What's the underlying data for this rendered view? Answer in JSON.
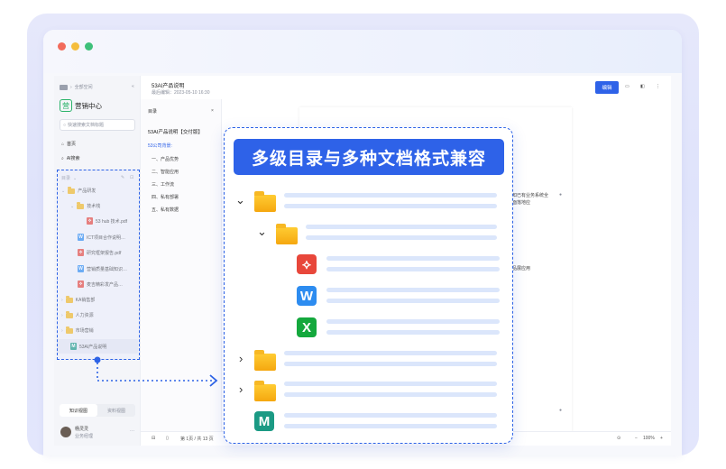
{
  "sidebar": {
    "breadcrumb": [
      "首页",
      "全部空间"
    ],
    "space_title": "营销中心",
    "space_logo_char": "营",
    "search_placeholder": "快速搜索文档标题",
    "nav": [
      {
        "label": "首页"
      },
      {
        "label": "AI搜索"
      }
    ],
    "dir_label": "目录",
    "tree": [
      {
        "label": "产品研发",
        "type": "folder",
        "level": 0
      },
      {
        "label": "技术栈",
        "type": "folder",
        "level": 1
      },
      {
        "label": "53 hub 技术.pdf",
        "type": "pdf",
        "level": 2
      },
      {
        "label": "ICT项目合作说明…",
        "type": "word",
        "level": 1
      },
      {
        "label": "研究框架报告.pdf",
        "type": "pdf",
        "level": 1
      },
      {
        "label": "营销质量基础知识…",
        "type": "word",
        "level": 1
      },
      {
        "label": "麦吉精彩发产品…",
        "type": "pdf",
        "level": 1
      },
      {
        "label": "KA销售部",
        "type": "folder",
        "level": 0
      },
      {
        "label": "人力资源",
        "type": "folder",
        "level": 0
      },
      {
        "label": "市场营销",
        "type": "folder",
        "level": 0
      },
      {
        "label": "53AI产品说明",
        "type": "md",
        "level": 0
      }
    ],
    "tabs": [
      "知识视图",
      "资料视图"
    ],
    "user": {
      "name": "杨灵灵",
      "role": "业务经理"
    }
  },
  "header": {
    "doc_title": "53AI产品说明",
    "meta": "最后编辑：2023-05-10 16:30",
    "edit_button": "编辑"
  },
  "toc": {
    "title": "目录",
    "doc_heading": "53AI产品说明【交付版】",
    "section": "53公司背景:",
    "items": [
      "一、产品优势",
      "二、智能应用",
      "三、工作流",
      "四、私有部署",
      "五、私有数据"
    ]
  },
  "document": {
    "snippet_1": "知已有业务系统全面落地应",
    "snippet_2": "品展应用"
  },
  "footer": {
    "pages": "第 1页 / 共 13 页",
    "zoom": "100%"
  },
  "overlay": {
    "title": "多级目录与多种文档格式兼容",
    "icons": {
      "pdf": "pdf-icon",
      "word": "word-icon",
      "excel": "excel-icon",
      "markdown": "markdown-icon"
    },
    "letters": {
      "word": "W",
      "excel": "X",
      "markdown": "M"
    }
  },
  "colors": {
    "accent": "#2e62e8",
    "folder": "#f5b91e",
    "pdf": "#e8473b",
    "word": "#2d8cf0",
    "excel": "#14a83d",
    "markdown": "#1b9a84"
  }
}
